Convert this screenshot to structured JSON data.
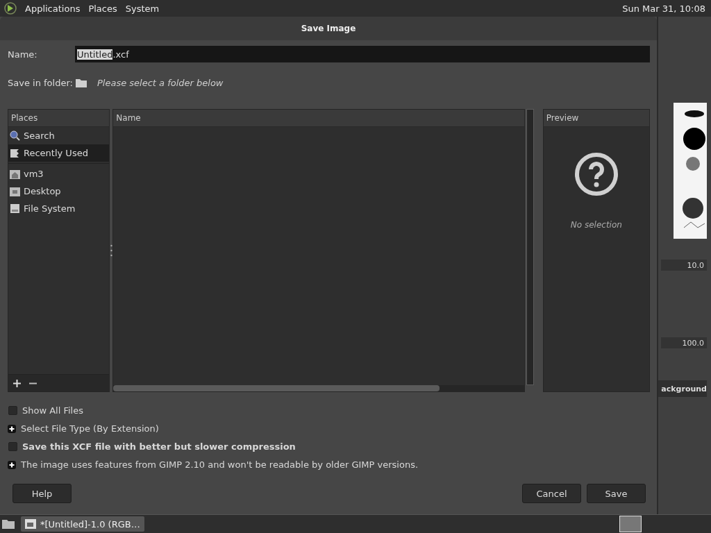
{
  "top_panel": {
    "menus": [
      "Applications",
      "Places",
      "System"
    ],
    "clock": "Sun Mar 31, 10:08"
  },
  "dialog": {
    "title": "Save Image",
    "name_label": "Name:",
    "name_field": {
      "value": "Untitled.xcf",
      "stem_selected": true
    },
    "folder_label": "Save in folder:",
    "folder_hint": "Please select a folder below",
    "places": {
      "header": "Places",
      "items": [
        {
          "label": "Search",
          "kind": "search",
          "selected": false
        },
        {
          "label": "Recently Used",
          "kind": "recent",
          "selected": true
        },
        {
          "kind": "separator"
        },
        {
          "label": "vm3",
          "kind": "home",
          "selected": false
        },
        {
          "label": "Desktop",
          "kind": "desktop",
          "selected": false
        },
        {
          "label": "File System",
          "kind": "drive",
          "selected": false
        }
      ]
    },
    "files": {
      "header": "Name"
    },
    "preview": {
      "header": "Preview",
      "message": "No selection"
    },
    "options": [
      {
        "kind": "checkbox",
        "label": "Show All Files",
        "checked": false,
        "bold": false
      },
      {
        "kind": "expander",
        "label": "Select File Type (By Extension)",
        "expanded": false,
        "bold": false
      },
      {
        "kind": "checkbox",
        "label": "Save this XCF file with better but slower compression",
        "checked": false,
        "bold": true
      },
      {
        "kind": "expander",
        "label": "The image uses features from GIMP 2.10 and won't be readable by older GIMP versions.",
        "expanded": false,
        "bold": false
      }
    ],
    "help_button": "Help",
    "buttons": [
      "Cancel",
      "Save"
    ]
  },
  "background_window": {
    "size_value": "10.0",
    "opacity_value": "100.0",
    "layer_name": "ackground"
  },
  "taskbar": {
    "tasks": [
      {
        "label": "*[Untitled]-1.0 (RGB…",
        "selected": true
      }
    ]
  }
}
